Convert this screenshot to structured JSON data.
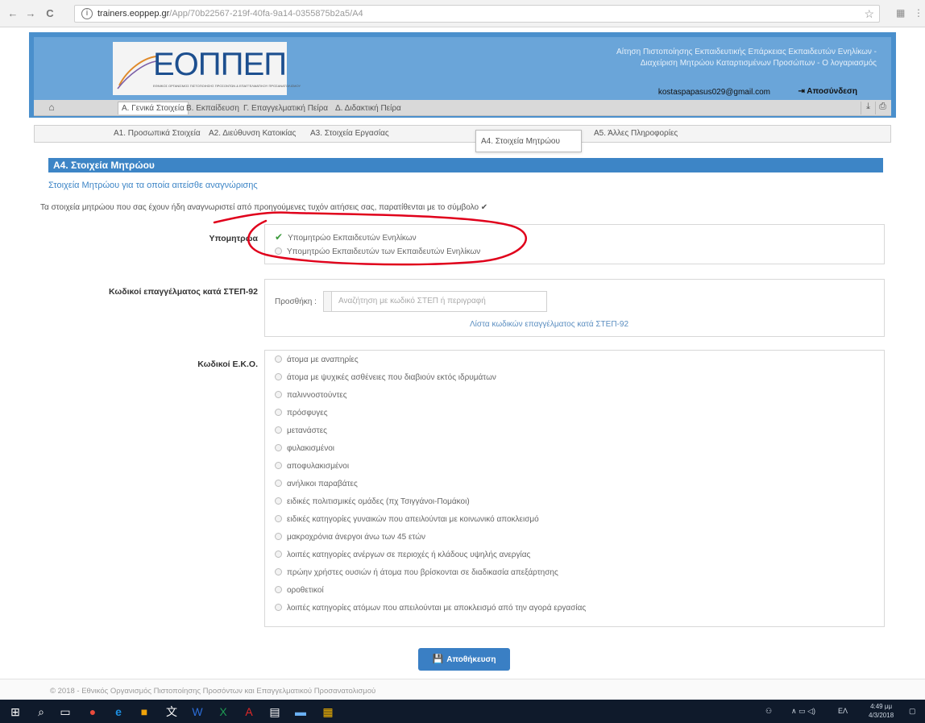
{
  "browser": {
    "url_host": "trainers.eoppep.gr",
    "url_path": "/App/70b22567-219f-40fa-9a14-0355875b2a5/A4"
  },
  "header": {
    "logo_text": "ΕΟΠΠΕΠ",
    "logo_subtitle": "ΕΘΝΙΚΟΣ ΟΡΓΑΝΙΣΜΟΣ ΠΙΣΤΟΠΟΙΗΣΗΣ ΠΡΟΣΟΝΤΩΝ & ΕΠΑΓΓΕΛΜΑΤΙΚΟΥ ΠΡΟΣΑΝΑΤΟΛΙΣΜΟΥ",
    "title_line1": "Αίτηση Πιστοποίησης Εκπαιδευτικής Επάρκειας Εκπαιδευτών Ενηλίκων -",
    "title_line2": "Διαχείριση Μητρώου Καταρτισμένων Προσώπων - Ο λογαριασμός",
    "user_email": "kostaspapasus029@gmail.com",
    "logout_label": "Αποσύνδεση"
  },
  "nav": {
    "tabs": [
      {
        "label": "Α. Γενικά Στοιχεία",
        "active": true
      },
      {
        "label": "Β. Εκπαίδευση",
        "active": false
      },
      {
        "label": "Γ. Επαγγελματική Πείρα",
        "active": false
      },
      {
        "label": "Δ. Διδακτική Πείρα",
        "active": false
      }
    ]
  },
  "subnav": {
    "items": [
      "Α1. Προσωπικά Στοιχεία",
      "Α2. Διεύθυνση Κατοικίας",
      "Α3. Στοιχεία Εργασίας",
      "Α4. Στοιχεία Μητρώου",
      "Α5. Άλλες Πληροφορίες"
    ]
  },
  "section": {
    "title": "Α4. Στοιχεία Μητρώου",
    "subtitle": "Στοιχεία Μητρώου για τα οποία αιτείσθε αναγνώρισης",
    "note": "Τα στοιχεία μητρώου που σας έχουν ήδη αναγνωριστεί από προηγούμενες τυχόν αιτήσεις σας, παρατίθενται με το σύμβολο ✔"
  },
  "submitroa": {
    "label": "Υπομητρώα",
    "options": [
      {
        "label": "Υπομητρώο Εκπαιδευτών Ενηλίκων",
        "checked": true
      },
      {
        "label": "Υπομητρώο Εκπαιδευτών των Εκπαιδευτών Ενηλίκων",
        "checked": false
      }
    ]
  },
  "step92": {
    "label": "Κωδικοί επαγγέλματος κατά ΣΤΕΠ-92",
    "add_label": "Προσθήκη :",
    "placeholder": "Αναζήτηση με κωδικό ΣΤΕΠ ή περιγραφή",
    "link": "Λίστα κωδικών επαγγέλματος κατά ΣΤΕΠ-92"
  },
  "eko": {
    "label": "Κωδικοί Ε.Κ.Ο.",
    "options": [
      "άτομα με αναπηρίες",
      "άτομα με ψυχικές ασθένειες που διαβιούν εκτός ιδρυμάτων",
      "παλιννοστούντες",
      "πρόσφυγες",
      "μετανάστες",
      "φυλακισμένοι",
      "αποφυλακισμένοι",
      "ανήλικοι παραβάτες",
      "ειδικές πολιτισμικές ομάδες (πχ Τσιγγάνοι-Πομάκοι)",
      "ειδικές κατηγορίες γυναικών που απειλούνται με κοινωνικό αποκλεισμό",
      "μακροχρόνια άνεργοι άνω των 45 ετών",
      "λοιπές κατηγορίες ανέργων σε περιοχές ή κλάδους υψηλής ανεργίας",
      "πρώην χρήστες ουσιών ή άτομα που βρίσκονται σε διαδικασία απεξάρτησης",
      "οροθετικοί",
      "λοιπές κατηγορίες ατόμων που απειλούνται με αποκλεισμό από την αγορά εργασίας"
    ]
  },
  "save_label": "Αποθήκευση",
  "footer": "© 2018 - Εθνικός Οργανισμός Πιστοποίησης Προσόντων και Επαγγελματικού Προσανατολισμού",
  "taskbar": {
    "time": "4:49 μμ",
    "date": "4/3/2018",
    "lang": "ΕΛ"
  },
  "colors": {
    "accent": "#3d85c6",
    "header": "#6aa5d9",
    "annotation": "#e0001b",
    "check": "#3a9a3a"
  }
}
